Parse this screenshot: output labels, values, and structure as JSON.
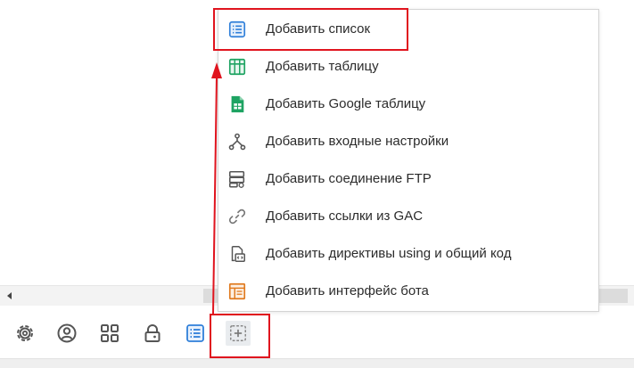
{
  "menu": {
    "items": [
      {
        "label": "Добавить список",
        "icon": "list-icon",
        "color": "#2f7fd9"
      },
      {
        "label": "Добавить таблицу",
        "icon": "table-icon",
        "color": "#1ea362"
      },
      {
        "label": "Добавить Google таблицу",
        "icon": "google-sheets-icon",
        "color": "#1ea362"
      },
      {
        "label": "Добавить входные настройки",
        "icon": "branch-icon",
        "color": "#555555"
      },
      {
        "label": "Добавить соединение FTP",
        "icon": "server-icon",
        "color": "#555555"
      },
      {
        "label": "Добавить ссылки из GAC",
        "icon": "link-icon",
        "color": "#777777"
      },
      {
        "label": "Добавить директивы using и общий код",
        "icon": "code-file-icon",
        "color": "#555555"
      },
      {
        "label": "Добавить интерфейс бота",
        "icon": "interface-icon",
        "color": "#e07a1f"
      }
    ]
  },
  "toolbar": {
    "buttons": [
      {
        "icon": "gear-icon"
      },
      {
        "icon": "user-circle-icon"
      },
      {
        "icon": "grid-icon"
      },
      {
        "icon": "lock-icon"
      },
      {
        "icon": "list-icon"
      },
      {
        "icon": "add-icon"
      }
    ]
  },
  "annotation_color": "#e0141e"
}
